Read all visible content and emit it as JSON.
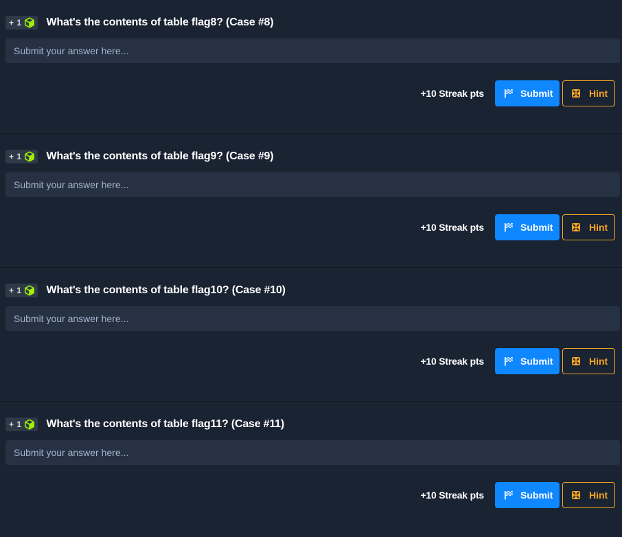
{
  "questions": [
    {
      "points": "+ 1",
      "title": "What's the contents of table flag8? (Case #8)",
      "answer_placeholder": "Submit your answer here...",
      "streak_label": "+10 Streak pts",
      "submit_label": "Submit",
      "hint_label": "Hint"
    },
    {
      "points": "+ 1",
      "title": "What's the contents of table flag9? (Case #9)",
      "answer_placeholder": "Submit your answer here...",
      "streak_label": "+10 Streak pts",
      "submit_label": "Submit",
      "hint_label": "Hint"
    },
    {
      "points": "+ 1",
      "title": "What's the contents of table flag10? (Case #10)",
      "answer_placeholder": "Submit your answer here...",
      "streak_label": "+10 Streak pts",
      "submit_label": "Submit",
      "hint_label": "Hint"
    },
    {
      "points": "+ 1",
      "title": "What's the contents of table flag11? (Case #11)",
      "answer_placeholder": "Submit your answer here...",
      "streak_label": "+10 Streak pts",
      "submit_label": "Submit",
      "hint_label": "Hint"
    }
  ],
  "icons": {
    "badge": "cube-icon",
    "submit": "flag-icon",
    "hint": "hint-icon"
  },
  "colors": {
    "background": "#1a2332",
    "input_background": "#263244",
    "submit_blue": "#0f87ff",
    "hint_orange": "#f5a524",
    "cube_green": "#9fef00"
  }
}
